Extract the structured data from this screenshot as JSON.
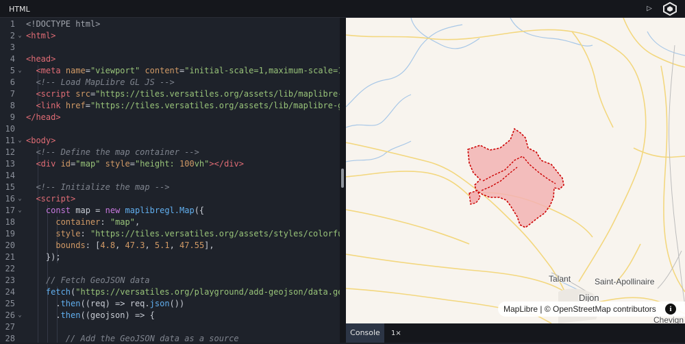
{
  "topbar": {
    "tab_label": "HTML",
    "run_icon": "play-icon",
    "logo_icon": "versatiles-logo-icon"
  },
  "editor": {
    "line_numbers": [
      "1",
      "2",
      "3",
      "4",
      "5",
      "6",
      "7",
      "8",
      "9",
      "10",
      "11",
      "12",
      "13",
      "14",
      "15",
      "16",
      "17",
      "18",
      "19",
      "20",
      "21",
      "22",
      "23",
      "24",
      "25",
      "26",
      "27",
      "28"
    ],
    "fold_lines": [
      2,
      5,
      11,
      16,
      17,
      26
    ],
    "lines": [
      [
        [
          "doc",
          "<!DOCTYPE html>"
        ]
      ],
      [
        [
          "tag",
          "<html>"
        ]
      ],
      [],
      [
        [
          "tag",
          "<head>"
        ]
      ],
      [
        [
          "pl",
          "  "
        ],
        [
          "tag",
          "<meta "
        ],
        [
          "attr",
          "name"
        ],
        [
          "pl",
          "="
        ],
        [
          "str",
          "\"viewport\""
        ],
        [
          "pl",
          " "
        ],
        [
          "attr",
          "content"
        ],
        [
          "pl",
          "="
        ],
        [
          "str",
          "\"initial-scale=1,maximum-scale=1"
        ]
      ],
      [
        [
          "pl",
          "  "
        ],
        [
          "com",
          "<!-- Load MapLibre GL JS -->"
        ]
      ],
      [
        [
          "pl",
          "  "
        ],
        [
          "tag",
          "<script "
        ],
        [
          "attr",
          "src"
        ],
        [
          "pl",
          "="
        ],
        [
          "str",
          "\"https://tiles.versatiles.org/assets/lib/maplibre-"
        ]
      ],
      [
        [
          "pl",
          "  "
        ],
        [
          "tag",
          "<link "
        ],
        [
          "attr",
          "href"
        ],
        [
          "pl",
          "="
        ],
        [
          "str",
          "\"https://tiles.versatiles.org/assets/lib/maplibre-g"
        ]
      ],
      [
        [
          "tag",
          "</head>"
        ]
      ],
      [],
      [
        [
          "tag",
          "<body>"
        ]
      ],
      [
        [
          "pl",
          "  "
        ],
        [
          "com",
          "<!-- Define the map container -->"
        ]
      ],
      [
        [
          "pl",
          "  "
        ],
        [
          "tag",
          "<div "
        ],
        [
          "attr",
          "id"
        ],
        [
          "pl",
          "="
        ],
        [
          "str",
          "\"map\""
        ],
        [
          "pl",
          " "
        ],
        [
          "attr",
          "style"
        ],
        [
          "pl",
          "="
        ],
        [
          "str",
          "\"height: "
        ],
        [
          "num",
          "100"
        ],
        [
          "str",
          "vh\""
        ],
        [
          "tag",
          "></div>"
        ]
      ],
      [],
      [
        [
          "pl",
          "  "
        ],
        [
          "com",
          "<!-- Initialize the map -->"
        ]
      ],
      [
        [
          "pl",
          "  "
        ],
        [
          "tag",
          "<script>"
        ]
      ],
      [
        [
          "pl",
          "    "
        ],
        [
          "kw",
          "const "
        ],
        [
          "pl",
          "map = "
        ],
        [
          "kw",
          "new "
        ],
        [
          "fn",
          "maplibregl.Map"
        ],
        [
          "pl",
          "({"
        ]
      ],
      [
        [
          "pl",
          "      "
        ],
        [
          "attr",
          "container"
        ],
        [
          "pl",
          ": "
        ],
        [
          "str",
          "\"map\""
        ],
        [
          "pl",
          ","
        ]
      ],
      [
        [
          "pl",
          "      "
        ],
        [
          "attr",
          "style"
        ],
        [
          "pl",
          ": "
        ],
        [
          "str",
          "\"https://tiles.versatiles.org/assets/styles/colorfu"
        ]
      ],
      [
        [
          "pl",
          "      "
        ],
        [
          "attr",
          "bounds"
        ],
        [
          "pl",
          ": ["
        ],
        [
          "num",
          "4.8"
        ],
        [
          "pl",
          ", "
        ],
        [
          "num",
          "47.3"
        ],
        [
          "pl",
          ", "
        ],
        [
          "num",
          "5.1"
        ],
        [
          "pl",
          ", "
        ],
        [
          "num",
          "47.55"
        ],
        [
          "pl",
          "],"
        ]
      ],
      [
        [
          "pl",
          "    });"
        ]
      ],
      [],
      [
        [
          "pl",
          "    "
        ],
        [
          "com",
          "// Fetch GeoJSON data"
        ]
      ],
      [
        [
          "pl",
          "    "
        ],
        [
          "fn",
          "fetch"
        ],
        [
          "pl",
          "("
        ],
        [
          "str",
          "\"https://versatiles.org/playground/add-geojson/data.ge"
        ]
      ],
      [
        [
          "pl",
          "      ."
        ],
        [
          "fn",
          "then"
        ],
        [
          "pl",
          "((req) => req."
        ],
        [
          "fn",
          "json"
        ],
        [
          "pl",
          "())"
        ]
      ],
      [
        [
          "pl",
          "      ."
        ],
        [
          "fn",
          "then"
        ],
        [
          "pl",
          "((geojson) => {"
        ]
      ],
      [],
      [
        [
          "pl",
          "        "
        ],
        [
          "com",
          "// Add the GeoJSON data as a source"
        ]
      ]
    ]
  },
  "map": {
    "places": [
      "Talant",
      "Saint-Apollinaire",
      "Dijon",
      "Chevign"
    ],
    "attribution": "MapLibre | © OpenStreetMap contributors",
    "info_icon": "info-icon",
    "colors": {
      "background": "#f8f4ee",
      "road": "#f3d77e",
      "river": "#a7c7e7",
      "polygon_fill": "#f2b3b3",
      "polygon_stroke": "#cc0000"
    }
  },
  "console": {
    "tab_label": "Console",
    "count": "1×"
  }
}
